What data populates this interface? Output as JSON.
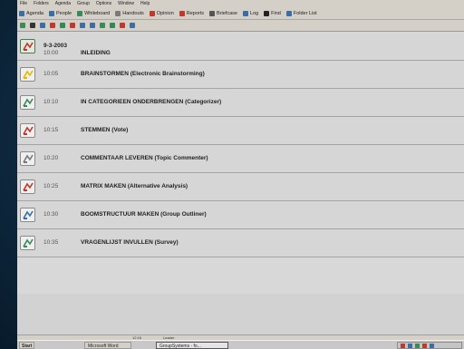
{
  "menu": [
    "File",
    "Folders",
    "Agenda",
    "Group",
    "Options",
    "Window",
    "Help"
  ],
  "toolbar": [
    {
      "label": "Agenda",
      "icon": "agenda-icon",
      "color": "#3a6ea5"
    },
    {
      "label": "People",
      "icon": "people-icon",
      "color": "#3a6ea5"
    },
    {
      "label": "Whiteboard",
      "icon": "whiteboard-icon",
      "color": "#3a8a5a"
    },
    {
      "label": "Handouts",
      "icon": "handouts-icon",
      "color": "#7a7a7a"
    },
    {
      "label": "Opinion",
      "icon": "opinion-icon",
      "color": "#c0392b"
    },
    {
      "label": "Reports",
      "icon": "reports-icon",
      "color": "#c0392b"
    },
    {
      "label": "Briefcase",
      "icon": "briefcase-icon",
      "color": "#555555"
    },
    {
      "label": "Log",
      "icon": "log-icon",
      "color": "#3a6ea5"
    },
    {
      "label": "Find",
      "icon": "find-icon",
      "color": "#222222"
    },
    {
      "label": "Folder List",
      "icon": "folder-list-icon",
      "color": "#3a6ea5"
    }
  ],
  "toolbar2_icons": [
    {
      "name": "tool-icon",
      "color": "#3a8a5a"
    },
    {
      "name": "close-icon",
      "color": "#333333"
    },
    {
      "name": "refresh-icon",
      "color": "#3a6ea5"
    },
    {
      "name": "record-icon",
      "color": "#c0392b"
    },
    {
      "name": "flag-green-icon",
      "color": "#2e8b57"
    },
    {
      "name": "flag-red-icon",
      "color": "#c0392b"
    },
    {
      "name": "back-icon",
      "color": "#3a6ea5"
    },
    {
      "name": "link-icon",
      "color": "#3a6ea5"
    },
    {
      "name": "pen-icon",
      "color": "#3a8a5a"
    },
    {
      "name": "arrows-icon",
      "color": "#2e8b57"
    },
    {
      "name": "arrows-red-icon",
      "color": "#c0392b"
    },
    {
      "name": "window-icon",
      "color": "#3a6ea5"
    }
  ],
  "date": "9-3-2003",
  "agenda": [
    {
      "time": "10:00",
      "title": "INLEIDING",
      "icon": "introduction-icon",
      "icon_color": "#c0392b",
      "active": true
    },
    {
      "time": "10:05",
      "title": "BRAINSTORMEN (Electronic Brainstorming)",
      "icon": "brainstorm-icon",
      "icon_color": "#e6b800",
      "active": false
    },
    {
      "time": "10:10",
      "title": "IN CATEGORIEEN ONDERBRENGEN (Categorizer)",
      "icon": "categorizer-icon",
      "icon_color": "#3a8a5a",
      "active": false
    },
    {
      "time": "10:15",
      "title": "STEMMEN (Vote)",
      "icon": "vote-icon",
      "icon_color": "#c0392b",
      "active": false
    },
    {
      "time": "10:20",
      "title": "COMMENTAAR LEVEREN (Topic Commenter)",
      "icon": "commenter-icon",
      "icon_color": "#7a7a7a",
      "active": false
    },
    {
      "time": "10:25",
      "title": "MATRIX MAKEN (Alternative Analysis)",
      "icon": "matrix-icon",
      "icon_color": "#c0392b",
      "active": false
    },
    {
      "time": "10:30",
      "title": "BOOMSTRUCTUUR MAKEN (Group Outliner)",
      "icon": "outliner-icon",
      "icon_color": "#3a6ea5",
      "active": false
    },
    {
      "time": "10:35",
      "title": "VRAGENLIJST INVULLEN (Survey)",
      "icon": "survey-icon",
      "icon_color": "#3a8a5a",
      "active": false
    }
  ],
  "status": {
    "time": "12:16",
    "role": "Leader"
  },
  "taskbar": {
    "start_label": "Start",
    "tasks": [
      "Microsoft Word",
      "GroupSystems - fo..."
    ]
  }
}
